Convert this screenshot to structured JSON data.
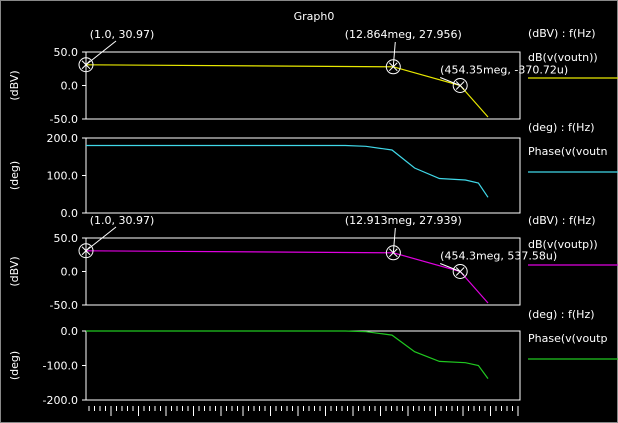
{
  "title": "Graph0",
  "chart_data": [
    {
      "type": "line",
      "ylabel": "(dBV)",
      "ylim": [
        -50,
        50
      ],
      "yticks": [
        "50.0",
        "0.0",
        "-50.0"
      ],
      "legend_unit": "(dBV) : f(Hz)",
      "series": [
        {
          "name": "dB(v(voutn))",
          "color": "#e8e800",
          "x": [
            1,
            12864000,
            454350000,
            2000000000
          ],
          "y": [
            30.97,
            27.956,
            -0.00037072,
            -47
          ]
        }
      ],
      "annotations": [
        {
          "x": 1,
          "y": 30.97,
          "label": "(1.0, 30.97)"
        },
        {
          "x": 12864000,
          "y": 27.956,
          "label": "(12.864meg, 27.956)"
        },
        {
          "x": 454350000,
          "y": -0.00037072,
          "label": "(454.35meg, -370.72u)"
        }
      ]
    },
    {
      "type": "line",
      "ylabel": "(deg)",
      "ylim": [
        0,
        200
      ],
      "yticks": [
        "200.0",
        "100.0",
        "0.0"
      ],
      "legend_unit": "(deg) : f(Hz)",
      "series": [
        {
          "name": "Phase(v(voutn",
          "color": "#40d8e8",
          "x": [
            1,
            1000000,
            3000000,
            12000000,
            40000000,
            150000000,
            600000000,
            1200000000,
            2000000000
          ],
          "y": [
            180,
            180,
            178,
            168,
            120,
            92,
            88,
            80,
            42
          ]
        }
      ]
    },
    {
      "type": "line",
      "ylabel": "(dBV)",
      "ylim": [
        -50,
        50
      ],
      "yticks": [
        "50.0",
        "0.0",
        "-50.0"
      ],
      "legend_unit": "(dBV) : f(Hz)",
      "series": [
        {
          "name": "dB(v(voutp))",
          "color": "#e000e0",
          "x": [
            1,
            12913000,
            454300000,
            2000000000
          ],
          "y": [
            30.97,
            27.939,
            0.00053758,
            -47
          ]
        }
      ],
      "annotations": [
        {
          "x": 1,
          "y": 30.97,
          "label": "(1.0, 30.97)"
        },
        {
          "x": 12913000,
          "y": 27.939,
          "label": "(12.913meg, 27.939)"
        },
        {
          "x": 454300000,
          "y": 0.00053758,
          "label": "(454.3meg, 537.58u)"
        }
      ]
    },
    {
      "type": "line",
      "ylabel": "(deg)",
      "ylim": [
        -200,
        0
      ],
      "yticks": [
        "0.0",
        "-100.0",
        "-200.0"
      ],
      "legend_unit": "(deg) : f(Hz)",
      "series": [
        {
          "name": "Phase(v(voutp",
          "color": "#20c820",
          "x": [
            1,
            1000000,
            3000000,
            12000000,
            40000000,
            150000000,
            600000000,
            1200000000,
            2000000000
          ],
          "y": [
            0,
            0,
            -2,
            -12,
            -60,
            -88,
            -92,
            -100,
            -138
          ]
        }
      ]
    }
  ]
}
